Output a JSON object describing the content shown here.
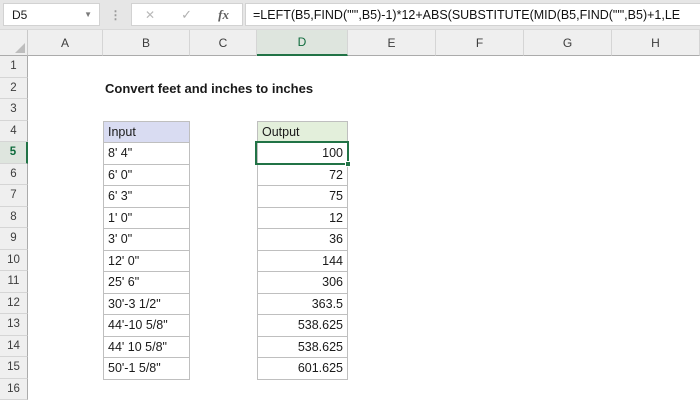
{
  "formula_bar": {
    "name_box": "D5",
    "cancel_icon": "✕",
    "enter_icon": "✓",
    "fx_icon": "fx",
    "formula": "=LEFT(B5,FIND(\"'\",B5)-1)*12+ABS(SUBSTITUTE(MID(B5,FIND(\"'\",B5)+1,LE"
  },
  "sheet": {
    "title": "Convert feet and inches to inches",
    "column_headers": [
      "A",
      "B",
      "C",
      "D",
      "E",
      "F",
      "G",
      "H"
    ],
    "row_headers": [
      "1",
      "2",
      "3",
      "4",
      "5",
      "6",
      "7",
      "8",
      "9",
      "10",
      "11",
      "12",
      "13",
      "14",
      "15",
      "16"
    ],
    "selected_cell": "D5",
    "selected_column": "D",
    "selected_row": "5",
    "table": {
      "input_header": "Input",
      "output_header": "Output",
      "rows": [
        {
          "input": "8' 4\"",
          "output": "100"
        },
        {
          "input": "6' 0\"",
          "output": "72"
        },
        {
          "input": "6' 3\"",
          "output": "75"
        },
        {
          "input": "1' 0\"",
          "output": "12"
        },
        {
          "input": "3' 0\"",
          "output": "36"
        },
        {
          "input": "12' 0\"",
          "output": "144"
        },
        {
          "input": "25' 6\"",
          "output": "306"
        },
        {
          "input": "30'-3 1/2\"",
          "output": "363.5"
        },
        {
          "input": "44'-10 5/8\"",
          "output": "538.625"
        },
        {
          "input": "44' 10 5/8\"",
          "output": "538.625"
        },
        {
          "input": "50'-1 5/8\"",
          "output": "601.625"
        }
      ]
    },
    "colors": {
      "selection_green": "#217346",
      "selected_header_bg": "#DEE5DE",
      "selected_header_text": "#0E6B3C",
      "input_header_fill": "#D9DCF2",
      "output_header_fill": "#E3EFDB",
      "table_border": "#BFBFBF"
    }
  }
}
